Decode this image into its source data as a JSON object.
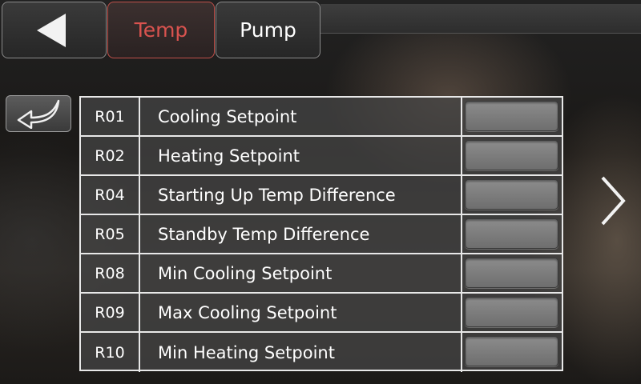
{
  "topbar": {
    "back_icon": "triangle-left-icon",
    "tabs": [
      {
        "label": "Temp",
        "active": true,
        "color": "#d9534f"
      },
      {
        "label": "Pump",
        "active": false,
        "color": "#ffffff"
      }
    ]
  },
  "return_button": {
    "icon": "return-arrow-icon"
  },
  "parameters": [
    {
      "code": "R01",
      "name": "Cooling Setpoint",
      "value": ""
    },
    {
      "code": "R02",
      "name": "Heating Setpoint",
      "value": ""
    },
    {
      "code": "R04",
      "name": "Starting Up Temp Difference",
      "value": ""
    },
    {
      "code": "R05",
      "name": "Standby Temp Difference",
      "value": ""
    },
    {
      "code": "R08",
      "name": "Min Cooling Setpoint",
      "value": ""
    },
    {
      "code": "R09",
      "name": "Max Cooling Setpoint",
      "value": ""
    },
    {
      "code": "R10",
      "name": "Min Heating Setpoint",
      "value": ""
    }
  ],
  "next_page_icon": "chevron-right-icon"
}
